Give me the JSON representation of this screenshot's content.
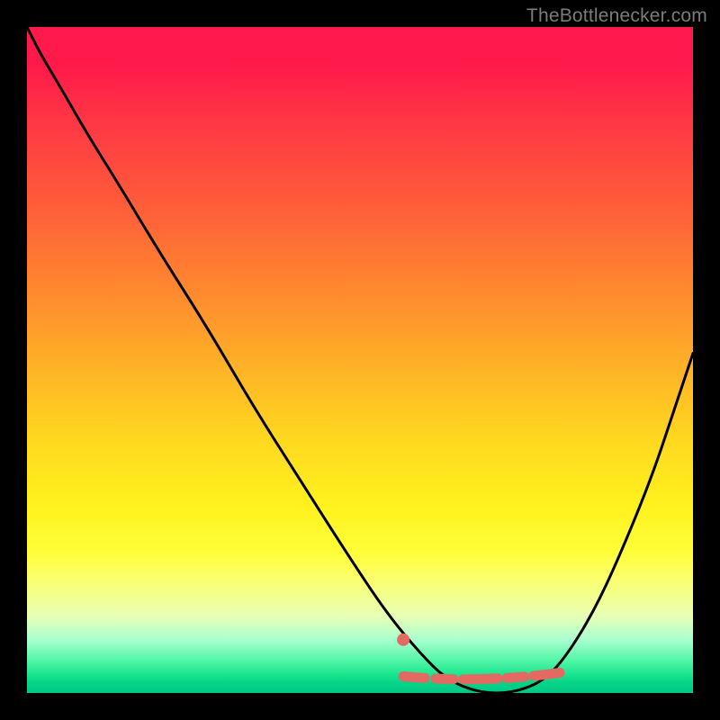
{
  "watermark": "TheBottlenecker.com",
  "chart_data": {
    "type": "line",
    "title": "",
    "xlabel": "",
    "ylabel": "",
    "x_range": [
      0,
      100
    ],
    "y_range": [
      0,
      100
    ],
    "gradient_stops": [
      {
        "pos": 0,
        "color": "#ff1a4b"
      },
      {
        "pos": 6,
        "color": "#ff1a4b"
      },
      {
        "pos": 14,
        "color": "#ff3644"
      },
      {
        "pos": 26,
        "color": "#ff5a3a"
      },
      {
        "pos": 40,
        "color": "#ff8a2e"
      },
      {
        "pos": 52,
        "color": "#ffb526"
      },
      {
        "pos": 62,
        "color": "#ffd81f"
      },
      {
        "pos": 72,
        "color": "#fff21e"
      },
      {
        "pos": 79,
        "color": "#fffe3a"
      },
      {
        "pos": 83,
        "color": "#fbff6e"
      },
      {
        "pos": 88.5,
        "color": "#e8ffb5"
      },
      {
        "pos": 92,
        "color": "#a9ffcf"
      },
      {
        "pos": 95,
        "color": "#56f7a8"
      },
      {
        "pos": 97.3,
        "color": "#18e58e"
      },
      {
        "pos": 98.4,
        "color": "#06d488"
      },
      {
        "pos": 100,
        "color": "#00c986"
      }
    ],
    "series": [
      {
        "name": "bottleneck-curve",
        "color": "#000000",
        "x": [
          0,
          2,
          5,
          9,
          14,
          20,
          27,
          34,
          41,
          48,
          54,
          59,
          63,
          68,
          73,
          78,
          82,
          86,
          90,
          94,
          97,
          100
        ],
        "y": [
          100,
          96,
          91,
          84,
          76,
          66,
          55,
          43,
          32,
          21,
          12,
          6,
          2,
          0,
          0,
          2,
          7,
          14,
          23,
          33,
          42,
          51
        ]
      }
    ],
    "highlight": {
      "name": "optimal-range-marker",
      "color": "#e36a62",
      "x_start": 56.5,
      "x_end": 80,
      "y": 2.5,
      "dot_x": 56.5,
      "dot_y": 8
    },
    "annotations": []
  }
}
